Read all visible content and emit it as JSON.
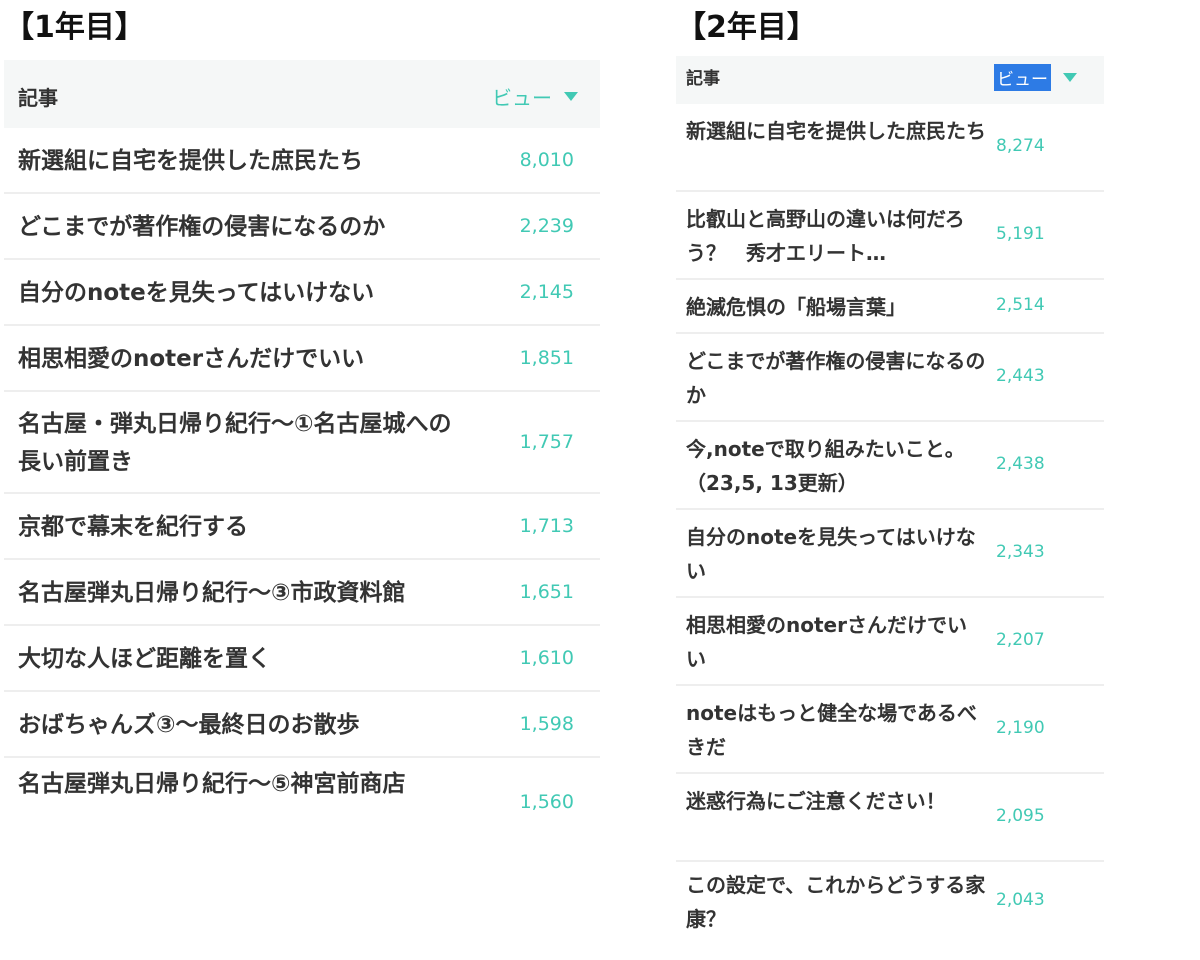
{
  "year1": {
    "heading": "【1年目】",
    "header": {
      "article_label": "記事",
      "views_label": "ビュー"
    },
    "rows": [
      {
        "title": "新選組に自宅を提供した庶民たち",
        "views": "8,010"
      },
      {
        "title": "どこまでが著作権の侵害になるのか",
        "views": "2,239"
      },
      {
        "title": "自分のnoteを見失ってはいけない",
        "views": "2,145"
      },
      {
        "title": "相思相愛のnoterさんだけでいい",
        "views": "1,851"
      },
      {
        "title": "名古屋・弾丸日帰り紀行〜①名古屋城への長い前置き",
        "views": "1,757"
      },
      {
        "title": "京都で幕末を紀行する",
        "views": "1,713"
      },
      {
        "title": "名古屋弾丸日帰り紀行〜③市政資料館",
        "views": "1,651"
      },
      {
        "title": "大切な人ほど距離を置く",
        "views": "1,610"
      },
      {
        "title": "おばちゃんズ③〜最終日のお散歩",
        "views": "1,598"
      },
      {
        "title": "名古屋弾丸日帰り紀行〜⑤神宮前商店",
        "views": "1,560"
      }
    ]
  },
  "year2": {
    "heading": "【2年目】",
    "header": {
      "article_label": "記事",
      "views_label": "ビュー"
    },
    "rows": [
      {
        "title": "新選組に自宅を提供した庶民たち",
        "views": "8,274"
      },
      {
        "title": "比叡山と高野山の違いは何だろう？　秀才エリート…",
        "views": "5,191"
      },
      {
        "title": "絶滅危惧の「船場言葉」",
        "views": "2,514"
      },
      {
        "title": "どこまでが著作権の侵害になるのか",
        "views": "2,443"
      },
      {
        "title": "今,noteで取り組みたいこと。　　　（23,5, 13更新）",
        "views": "2,438"
      },
      {
        "title": "自分のnoteを見失ってはいけない",
        "views": "2,343"
      },
      {
        "title": "相思相愛のnoterさんだけでいい",
        "views": "2,207"
      },
      {
        "title": "noteはもっと健全な場であるべきだ",
        "views": "2,190"
      },
      {
        "title": "迷惑行為にご注意ください！",
        "views": "2,095"
      },
      {
        "title": "この設定で、これからどうする家康？",
        "views": "2,043"
      }
    ]
  },
  "colors": {
    "accent": "#41c9b4",
    "header_bg": "#f5f7f7",
    "selected_bg": "#2d7be5",
    "divider": "#eeeeee",
    "text": "#333333"
  },
  "icons": {
    "sort": "caret-down-icon"
  }
}
